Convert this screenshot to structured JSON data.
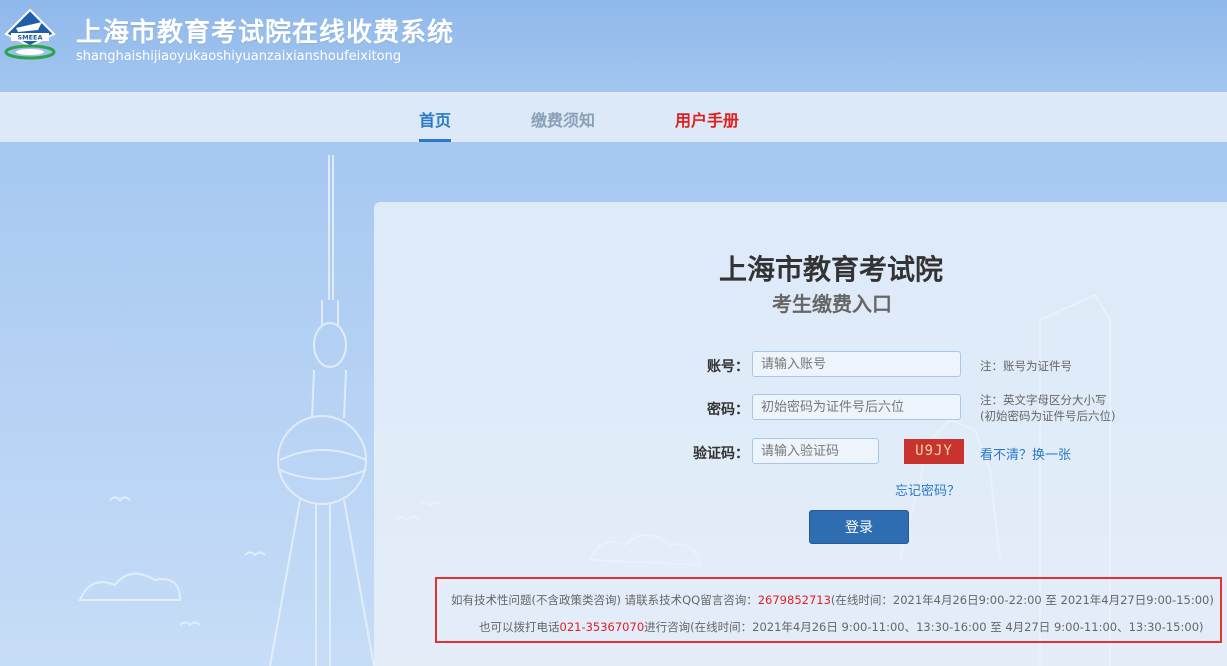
{
  "header": {
    "title": "上海市教育考试院在线收费系统",
    "subtitle": "shanghaishijiaoyukaoshiyuanzaixianshoufeixitong",
    "logo_text": "SMEEA"
  },
  "nav": {
    "home": "首页",
    "notice": "缴费须知",
    "manual": "用户手册"
  },
  "panel": {
    "title": "上海市教育考试院",
    "subtitle": "考生缴费入口"
  },
  "form": {
    "account_label": "账号：",
    "account_placeholder": "请输入账号",
    "account_note": "注：账号为证件号",
    "password_label": "密码：",
    "password_placeholder": "初始密码为证件号后六位",
    "password_note_1": "注：英文字母区分大小写",
    "password_note_2": "(初始密码为证件号后六位)",
    "captcha_label": "验证码：",
    "captcha_placeholder": "请输入验证码",
    "captcha_text": "U9JY",
    "refresh_link": "看不清？换一张",
    "forgot_link": "忘记密码？",
    "login_button": "登录"
  },
  "contact": {
    "line1_prefix": "如有技术性问题(不含政策类咨询)   请联系技术QQ留言咨询：",
    "line1_qq": "2679852713",
    "line1_suffix": "(在线时间：2021年4月26日9:00-22:00 至 2021年4月27日9:00-15:00)",
    "line2_prefix": "也可以拨打电话",
    "line2_phone": "021-35367070",
    "line2_suffix": "进行咨询(在线时间：2021年4月26日 9:00-11:00、13:30-16:00 至 4月27日 9:00-11:00、13:30-15:00)"
  },
  "colors": {
    "accent": "#2a78c7",
    "alert": "#e02020",
    "button": "#2f6db2"
  }
}
